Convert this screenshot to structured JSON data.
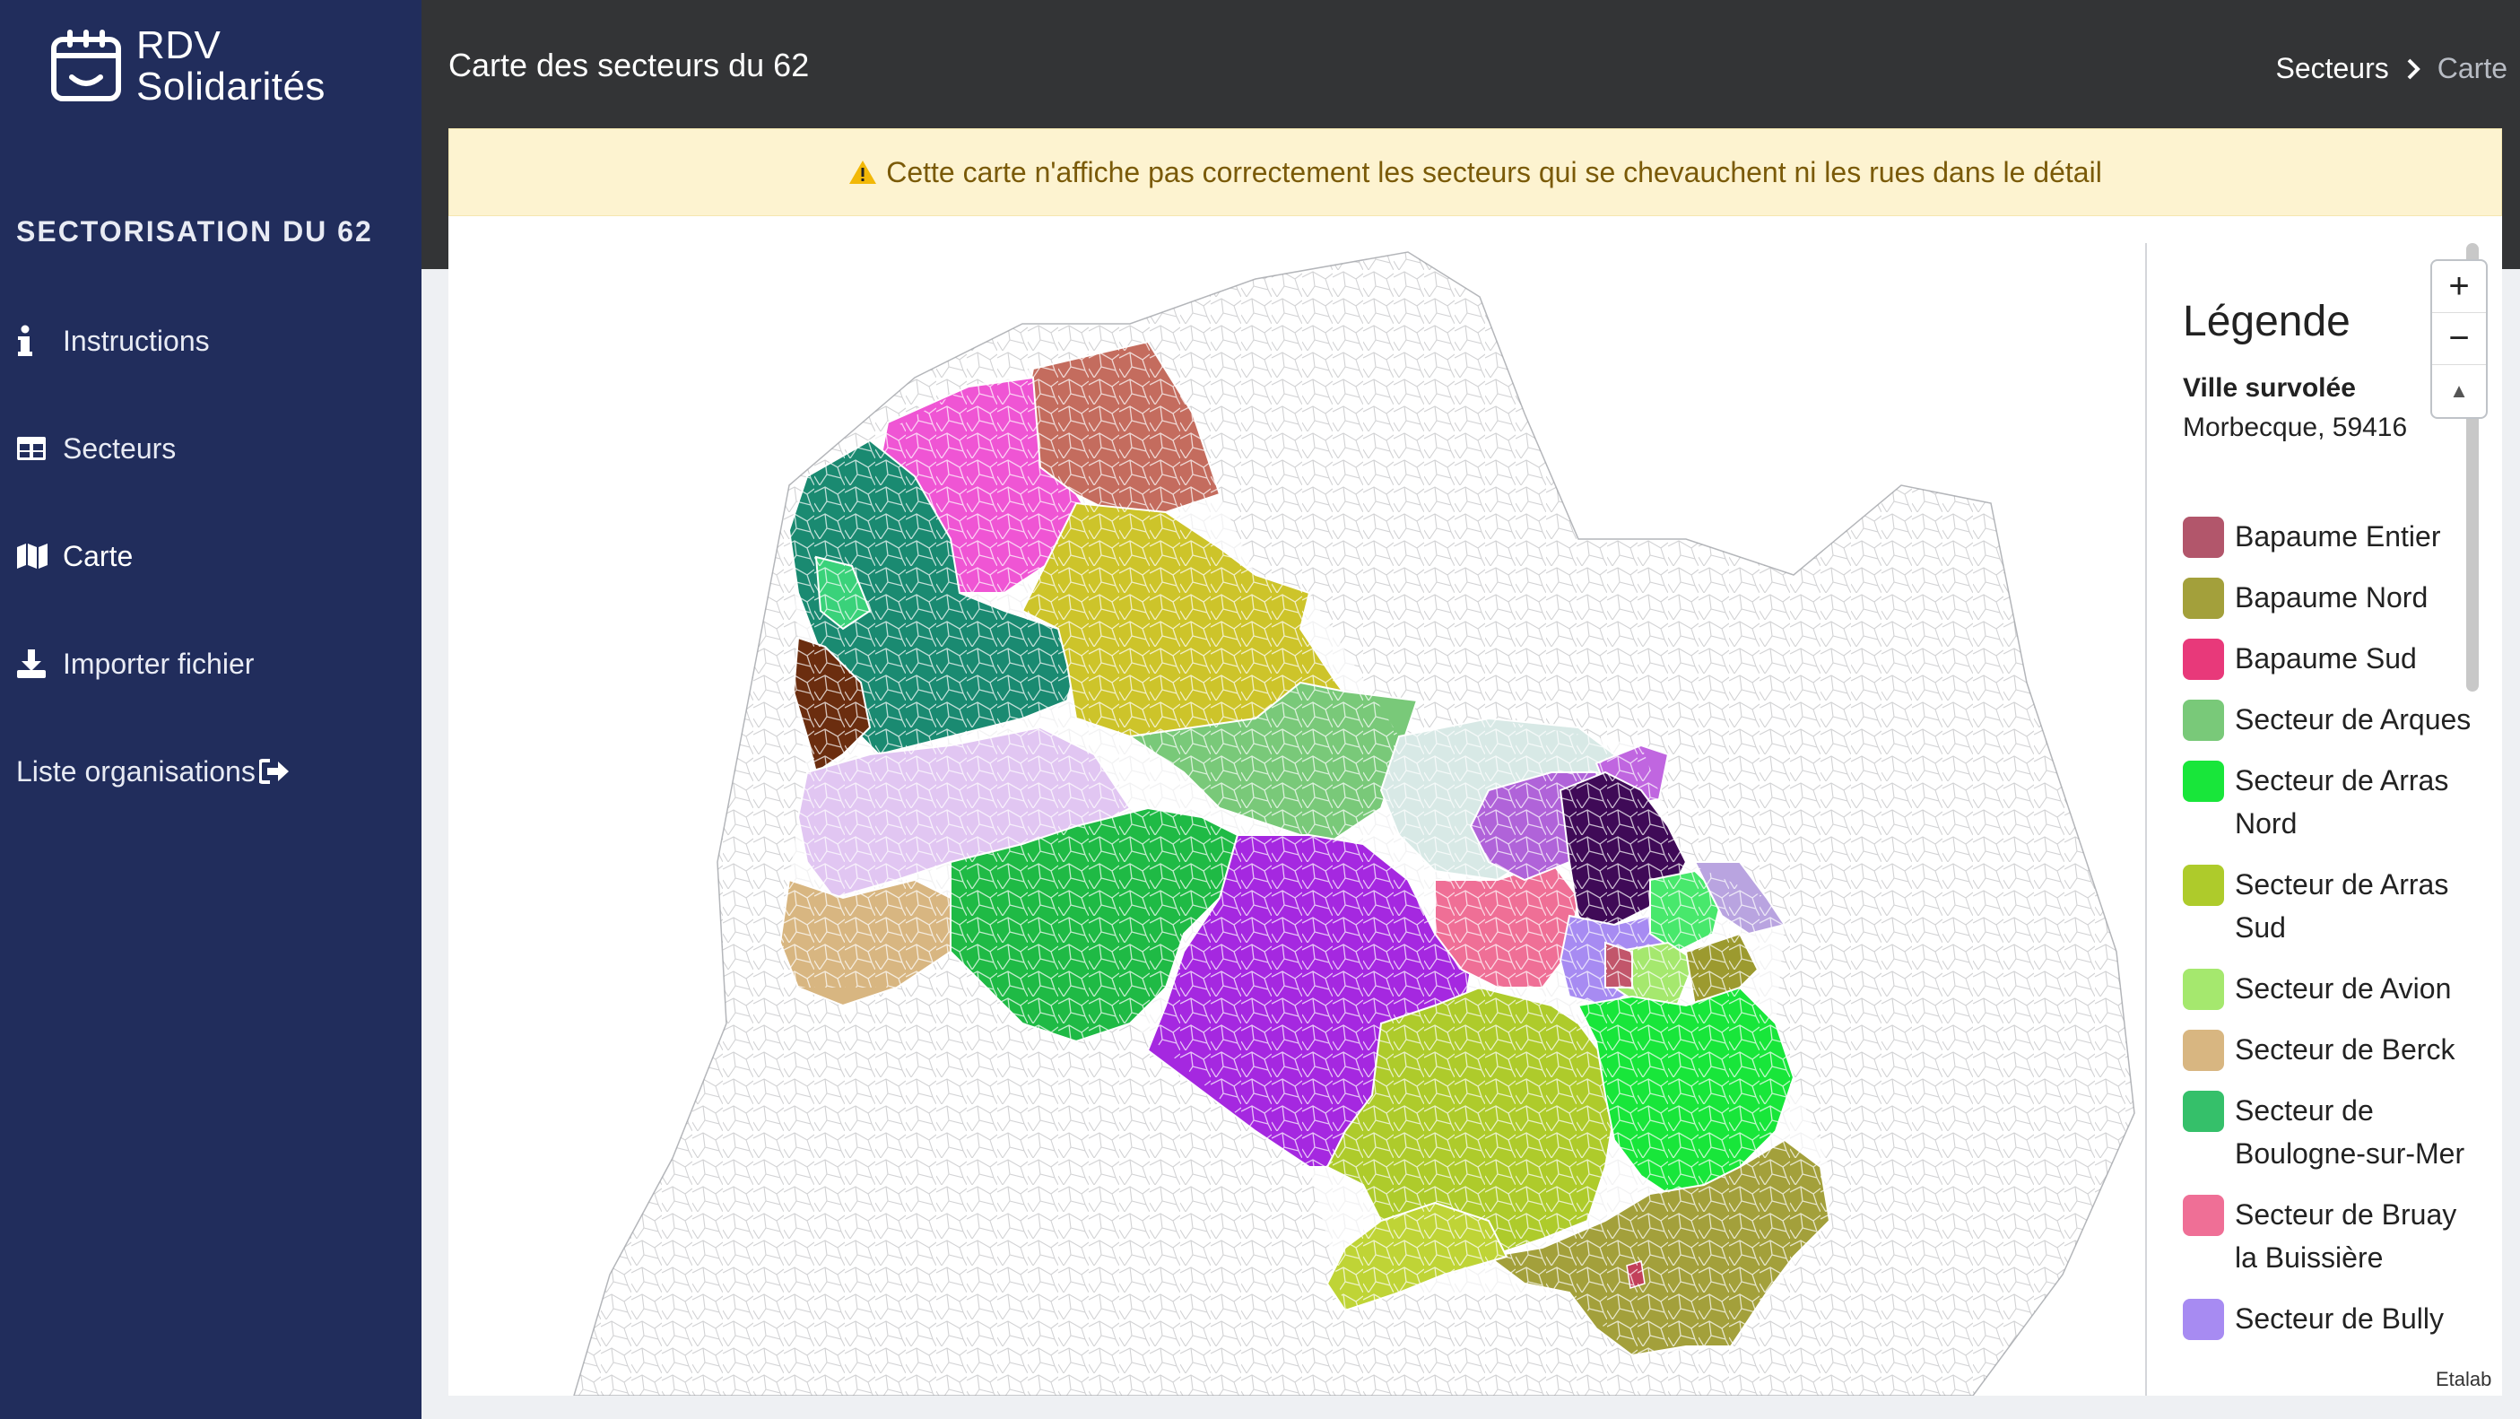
{
  "brand": {
    "line1": "RDV",
    "line2": "Solidarités"
  },
  "sidebar": {
    "section_title": "SECTORISATION DU 62",
    "items": [
      {
        "label": "Instructions",
        "icon": "info-icon"
      },
      {
        "label": "Secteurs",
        "icon": "table-icon"
      },
      {
        "label": "Carte",
        "icon": "map-icon"
      },
      {
        "label": "Importer fichier",
        "icon": "download-icon"
      },
      {
        "label": "Liste organisations",
        "icon": "sign-out-icon"
      }
    ]
  },
  "header": {
    "title": "Carte des secteurs du 62",
    "breadcrumb": {
      "parent": "Secteurs",
      "current": "Carte"
    }
  },
  "alert": {
    "text": "Cette carte n'affiche pas correctement les secteurs qui se chevauchent ni les rues dans le détail"
  },
  "legend": {
    "title": "Légende",
    "hover_label": "Ville survolée",
    "hover_value": "Morbecque, 59416",
    "items": [
      {
        "label": "Bapaume Entier",
        "color": "#b2566b"
      },
      {
        "label": "Bapaume Nord",
        "color": "#a3a03b"
      },
      {
        "label": "Bapaume Sud",
        "color": "#e8397a"
      },
      {
        "label": "Secteur de Arques",
        "color": "#79c979"
      },
      {
        "label": "Secteur de Arras Nord",
        "color": "#18e63a"
      },
      {
        "label": "Secteur de Arras Sud",
        "color": "#aecb2b"
      },
      {
        "label": "Secteur de Avion",
        "color": "#a5e86e"
      },
      {
        "label": "Secteur de Berck",
        "color": "#d8b681"
      },
      {
        "label": "Secteur de Boulogne-sur-Mer",
        "color": "#35c06a"
      },
      {
        "label": "Secteur de Bruay la Buissière",
        "color": "#ef6f96"
      },
      {
        "label": "Secteur de Bully",
        "color": "#a78bf2"
      }
    ]
  },
  "map": {
    "zoom_in": "+",
    "zoom_out": "−",
    "reset": "▲",
    "attribution": "Etalab"
  }
}
